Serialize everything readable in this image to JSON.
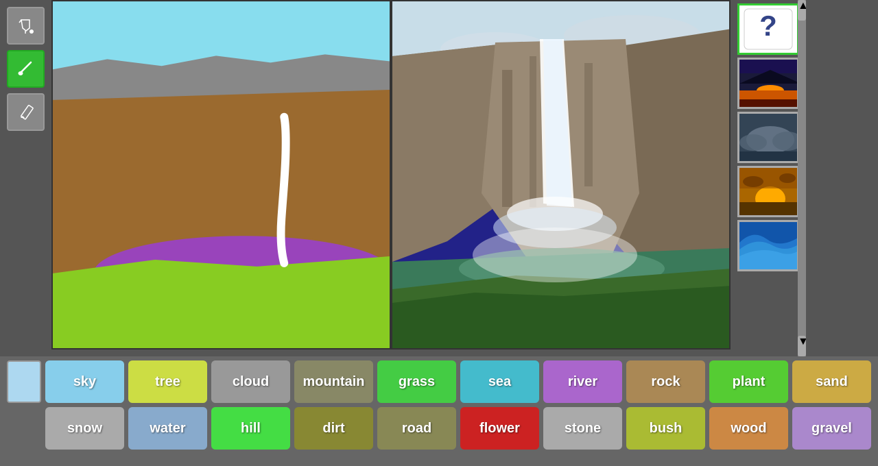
{
  "toolbar": {
    "tools": [
      {
        "name": "fill-tool",
        "label": "Fill"
      },
      {
        "name": "brush-tool",
        "label": "Brush",
        "active": true
      },
      {
        "name": "pencil-tool",
        "label": "Pencil"
      }
    ]
  },
  "label_row1": [
    {
      "id": "swatch",
      "label": "",
      "color": "#add8f0"
    },
    {
      "id": "sky",
      "label": "sky",
      "color": "#87ceeb"
    },
    {
      "id": "tree",
      "label": "tree",
      "color": "#ccdd44"
    },
    {
      "id": "cloud",
      "label": "cloud",
      "color": "#999999"
    },
    {
      "id": "mountain",
      "label": "mountain",
      "color": "#888866"
    },
    {
      "id": "grass",
      "label": "grass",
      "color": "#44cc44"
    },
    {
      "id": "sea",
      "label": "sea",
      "color": "#44bbcc"
    },
    {
      "id": "river",
      "label": "river",
      "color": "#aa66cc"
    },
    {
      "id": "rock",
      "label": "rock",
      "color": "#aa8855"
    },
    {
      "id": "plant",
      "label": "plant",
      "color": "#55cc33"
    },
    {
      "id": "sand",
      "label": "sand",
      "color": "#ccaa44"
    }
  ],
  "label_row2": [
    {
      "id": "snow",
      "label": "snow",
      "color": "#aaaaaa"
    },
    {
      "id": "water",
      "label": "water",
      "color": "#88aacc"
    },
    {
      "id": "hill",
      "label": "hill",
      "color": "#44dd44"
    },
    {
      "id": "dirt",
      "label": "dirt",
      "color": "#888833"
    },
    {
      "id": "road",
      "label": "road",
      "color": "#888855"
    },
    {
      "id": "flower",
      "label": "flower",
      "color": "#cc2222"
    },
    {
      "id": "stone",
      "label": "stone",
      "color": "#aaaaaa"
    },
    {
      "id": "bush",
      "label": "bush",
      "color": "#aabb33"
    },
    {
      "id": "wood",
      "label": "wood",
      "color": "#cc8844"
    },
    {
      "id": "gravel",
      "label": "gravel",
      "color": "#aa88cc"
    }
  ],
  "thumbnails": [
    {
      "id": "dice",
      "type": "dice"
    },
    {
      "id": "sunset1",
      "type": "sunset"
    },
    {
      "id": "clouds",
      "type": "clouds"
    },
    {
      "id": "sunset2",
      "type": "sunset2"
    },
    {
      "id": "wave",
      "type": "wave"
    }
  ]
}
